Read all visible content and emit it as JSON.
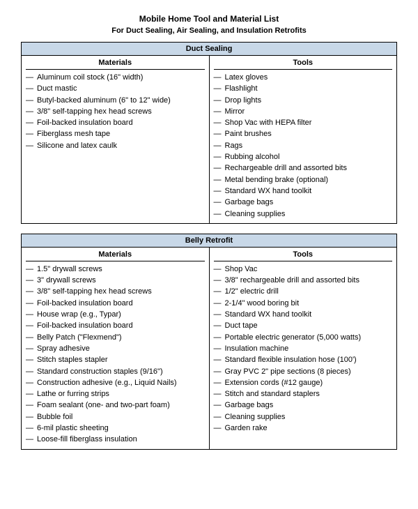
{
  "title": "Mobile Home Tool and Material List",
  "subtitle": "For Duct Sealing, Air Sealing, and Insulation Retrofits",
  "sections": [
    {
      "id": "duct-sealing",
      "header": "Duct Sealing",
      "col_left_header": "Materials",
      "col_right_header": "Tools",
      "materials": [
        "Aluminum coil stock (16\" width)",
        "Duct mastic",
        "Butyl-backed aluminum (6\" to 12\" wide)",
        "3/8\" self-tapping hex head screws",
        "Foil-backed insulation board",
        "Fiberglass mesh tape",
        "Silicone and latex caulk"
      ],
      "tools": [
        "Latex gloves",
        "Flashlight",
        "Drop lights",
        "Mirror",
        "Shop Vac with HEPA filter",
        "Paint brushes",
        "Rags",
        "Rubbing alcohol",
        "Rechargeable drill and assorted bits",
        "Metal bending brake (optional)",
        "Standard WX hand toolkit",
        "Garbage bags",
        "Cleaning supplies"
      ]
    },
    {
      "id": "belly-retrofit",
      "header": "Belly Retrofit",
      "col_left_header": "Materials",
      "col_right_header": "Tools",
      "materials": [
        "1.5\" drywall screws",
        "3\" drywall screws",
        "3/8\" self-tapping hex head screws",
        "Foil-backed insulation board",
        "House wrap (e.g., Typar)",
        "Foil-backed insulation board",
        "Belly Patch (\"Flexmend\")",
        "Spray adhesive",
        "Stitch staples stapler",
        "Standard construction staples (9/16\")",
        "Construction adhesive (e.g., Liquid Nails)",
        "Lathe or furring strips",
        "Foam sealant (one- and two-part foam)",
        "Bubble foil",
        "6-mil plastic sheeting",
        "Loose-fill fiberglass insulation"
      ],
      "tools": [
        "Shop Vac",
        "3/8\" rechargeable drill and assorted bits",
        "1/2\" electric drill",
        "2-1/4\" wood boring bit",
        "Standard WX hand toolkit",
        "Duct tape",
        "Portable electric generator (5,000 watts)",
        "Insulation machine",
        "Standard flexible insulation hose (100')",
        "Gray PVC 2\" pipe sections (8 pieces)",
        "Extension cords (#12 gauge)",
        "Stitch and standard staplers",
        "Garbage bags",
        "Cleaning supplies",
        "Garden rake"
      ]
    }
  ]
}
